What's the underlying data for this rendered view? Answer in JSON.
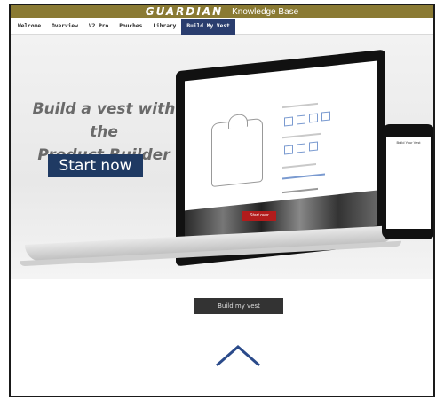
{
  "header": {
    "brand": "GUARDIAN",
    "subtitle": "Knowledge Base"
  },
  "nav": {
    "items": [
      "Welcome",
      "Overview",
      "V2 Pro",
      "Pouches",
      "Library",
      "Build My Vest"
    ],
    "active_index": 5
  },
  "hero": {
    "headline_line1": "Build a vest with the",
    "headline_line2": "Product Builder",
    "cta_label": "Start now",
    "laptop_button_label": "Start over",
    "phone_title": "Build Your Vest"
  },
  "main": {
    "build_button_label": "Build my vest"
  },
  "icons": {
    "scroll_top": "chevron-up-icon"
  },
  "colors": {
    "topbar": "#8a7a33",
    "nav_active": "#2a3d6e",
    "cta": "#1f3a63",
    "laptop_button": "#b11c1c",
    "build_button": "#333333",
    "chevron": "#2a4a8a"
  }
}
